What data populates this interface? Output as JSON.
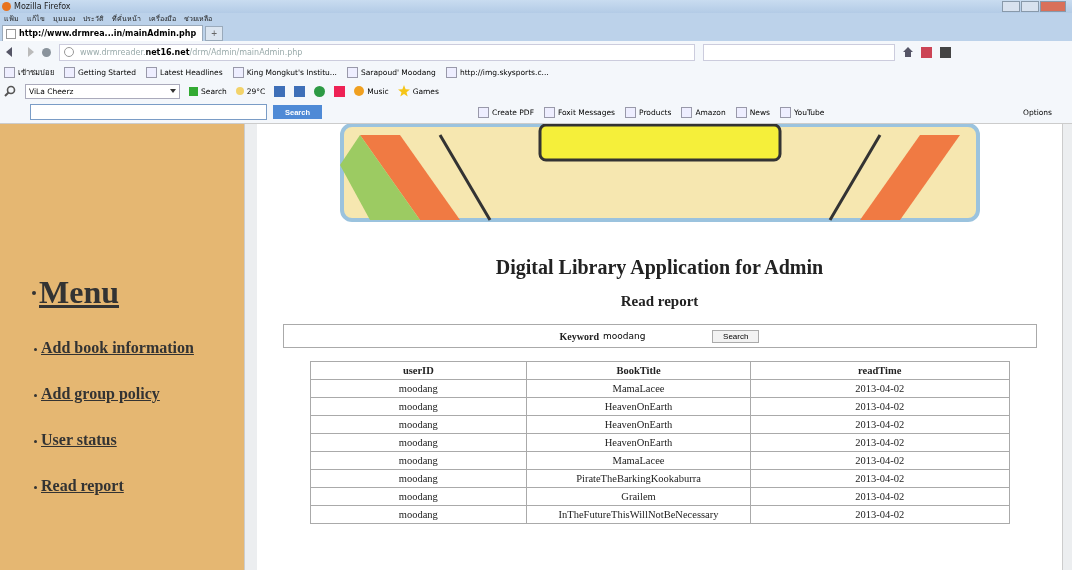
{
  "window": {
    "title": "Mozilla Firefox"
  },
  "menu_bar": [
    "แฟ้ม",
    "แก้ไข",
    "มุมมอง",
    "ประวัติ",
    "ที่คั่นหน้า",
    "เครื่องมือ",
    "ช่วยเหลือ"
  ],
  "tabs": [
    {
      "label": "http://www.drmrea...in/mainAdmin.php",
      "selected": true
    }
  ],
  "new_tab": "+",
  "address": {
    "prefix": "www.drmreader.",
    "domain": "net16.net",
    "path": "/drm/Admin/mainAdmin.php"
  },
  "bookmarks": [
    "เข้าชมบ่อย",
    "Getting Started",
    "Latest Headlines",
    "King Mongkut's Institu...",
    "Sarapoud' Moodang",
    "http://img.skysports.c..."
  ],
  "toolbar": {
    "profile": "ViLa Cheerz",
    "search": "Search",
    "weather": "29°C",
    "music": "Music",
    "games": "Games"
  },
  "toolbar2": {
    "search_button": "Search",
    "items": [
      "Create PDF",
      "Foxit Messages",
      "Products",
      "Amazon",
      "News",
      "YouTube"
    ],
    "options": "Options"
  },
  "sidebar": {
    "heading": "Menu",
    "items": [
      "Add book information",
      "Add group policy",
      "User status",
      "Read report"
    ]
  },
  "page": {
    "title": "Digital Library Application for Admin",
    "subtitle": "Read report",
    "keyword_label": "Keyword",
    "keyword_value": "moodang",
    "search_button": "Search"
  },
  "table": {
    "columns": [
      "userID",
      "BookTitle",
      "readTime"
    ],
    "rows": [
      [
        "moodang",
        "MamaLacee",
        "2013-04-02"
      ],
      [
        "moodang",
        "HeavenOnEarth",
        "2013-04-02"
      ],
      [
        "moodang",
        "HeavenOnEarth",
        "2013-04-02"
      ],
      [
        "moodang",
        "HeavenOnEarth",
        "2013-04-02"
      ],
      [
        "moodang",
        "MamaLacee",
        "2013-04-02"
      ],
      [
        "moodang",
        "PirateTheBarkingKookaburra",
        "2013-04-02"
      ],
      [
        "moodang",
        "Grailem",
        "2013-04-02"
      ],
      [
        "moodang",
        "InTheFutureThisWillNotBeNecessary",
        "2013-04-02"
      ]
    ]
  }
}
